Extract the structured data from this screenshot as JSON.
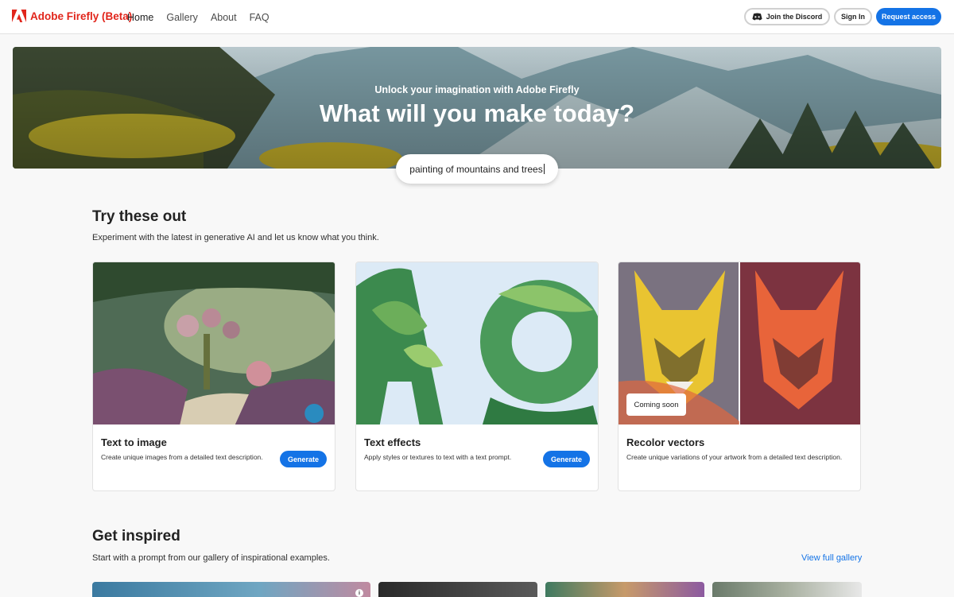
{
  "header": {
    "brand": "Adobe Firefly (Beta)",
    "nav": [
      "Home",
      "Gallery",
      "About",
      "FAQ"
    ],
    "active_nav": "Home",
    "discord_label": "Join the Discord",
    "signin_label": "Sign In",
    "request_label": "Request access"
  },
  "hero": {
    "subtitle": "Unlock your imagination with Adobe Firefly",
    "title": "What will you make today?",
    "prompt": "painting of mountains and trees"
  },
  "try_section": {
    "title": "Try these out",
    "description": "Experiment with the latest in generative AI and let us know what you think.",
    "cards": [
      {
        "title": "Text to image",
        "description": "Create unique images from a detailed text description.",
        "button": "Generate"
      },
      {
        "title": "Text effects",
        "description": "Apply styles or textures to text with a text prompt.",
        "button": "Generate"
      },
      {
        "title": "Recolor vectors",
        "description": "Create unique variations of your artwork from a detailed text description.",
        "badge": "Coming soon"
      }
    ]
  },
  "inspired_section": {
    "title": "Get inspired",
    "description": "Start with a prompt from our gallery of inspirational examples.",
    "view_gallery": "View full gallery"
  },
  "colors": {
    "brand_red": "#e1251b",
    "accent_blue": "#1473e6",
    "background": "#f8f8f8"
  },
  "icons": [
    "adobe-logo-icon",
    "discord-icon",
    "info-icon"
  ]
}
